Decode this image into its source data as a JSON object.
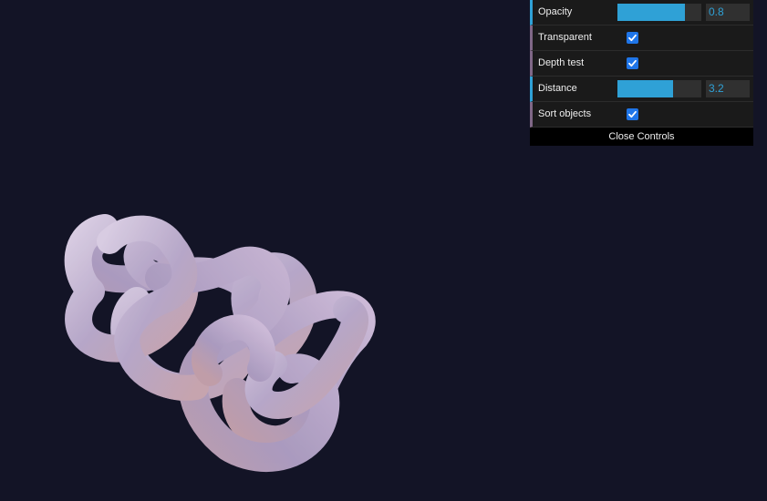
{
  "scene": {
    "background_color": "#131426",
    "object": "torus-knot",
    "material_color_light": "#d9c9e6",
    "material_color_mid": "#b9a7cc",
    "material_color_warm": "#d8b4bd"
  },
  "controls": {
    "opacity": {
      "label": "Opacity",
      "value": "0.8",
      "fraction": 0.8
    },
    "transparent": {
      "label": "Transparent",
      "checked": true
    },
    "depth_test": {
      "label": "Depth test",
      "checked": true
    },
    "distance": {
      "label": "Distance",
      "value": "3.2",
      "fraction": 0.66
    },
    "sort_objects": {
      "label": "Sort objects",
      "checked": true
    },
    "close_label": "Close Controls",
    "accent_color": "#2fa1d6",
    "boolean_color": "#806787"
  }
}
